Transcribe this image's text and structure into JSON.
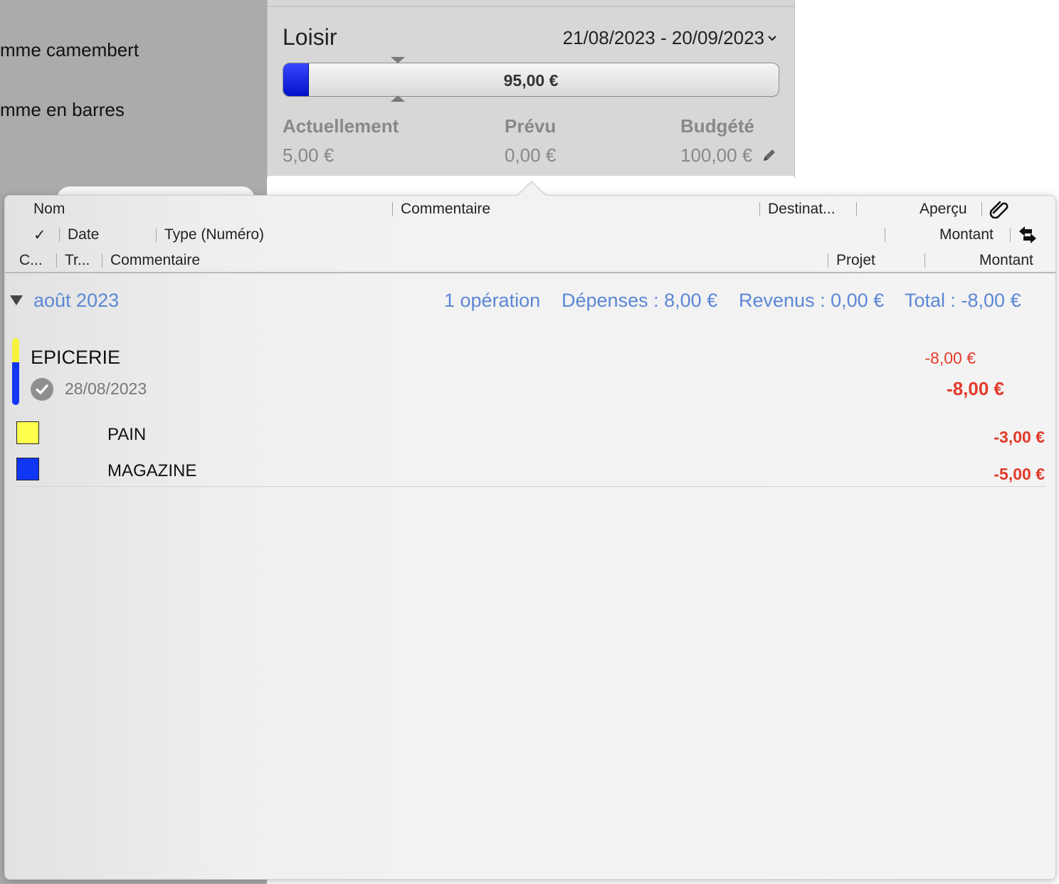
{
  "left_pane": {
    "item1": "mme camembert",
    "item2": "mme en barres"
  },
  "budget": {
    "category": "Loisir",
    "period": "21/08/2023 - 20/09/2023",
    "bar_label": "95,00 €",
    "spent_fraction": 0.05,
    "fill_color": "#0a1fe6",
    "stats": {
      "current_label": "Actuellement",
      "current_value": "5,00 €",
      "planned_label": "Prévu",
      "planned_value": "0,00 €",
      "budgeted_label": "Budgété",
      "budgeted_value": "100,00 €"
    }
  },
  "columns": {
    "row1": {
      "name": "Nom",
      "comment": "Commentaire",
      "destination": "Destinat...",
      "preview": "Aperçu"
    },
    "row2": {
      "check": "✓",
      "date": "Date",
      "type": "Type (Numéro)",
      "amount": "Montant"
    },
    "row3": {
      "c": "C...",
      "tr": "Tr...",
      "comment": "Commentaire",
      "project": "Projet",
      "amount": "Montant"
    }
  },
  "group": {
    "month": "août 2023",
    "count": "1 opération",
    "expenses": "Dépenses : 8,00 €",
    "income": "Revenus : 0,00 €",
    "total": "Total : -8,00 €"
  },
  "transaction": {
    "name": "EPICERIE",
    "date": "28/08/2023",
    "amount_small": "-8,00 €",
    "amount_large": "-8,00 €",
    "splits": [
      {
        "name": "PAIN",
        "amount": "-3,00 €",
        "color": "#ffff4d"
      },
      {
        "name": "MAGAZINE",
        "amount": "-5,00 €",
        "color": "#1236f5"
      }
    ]
  },
  "colors": {
    "accent_blue": "#5b87d6",
    "negative_red": "#e23a2a"
  }
}
